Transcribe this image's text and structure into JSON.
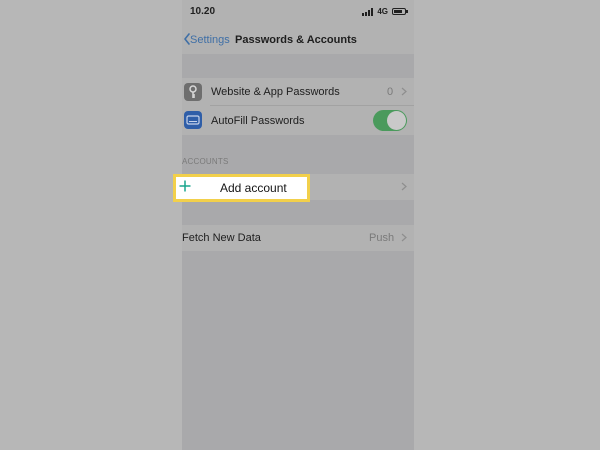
{
  "status_bar": {
    "time": "10.20",
    "network": "4G",
    "signal_icon": "cellular-signal-icon",
    "battery_icon": "battery-icon"
  },
  "nav": {
    "back_label": "Settings",
    "title": "Passwords & Accounts"
  },
  "passwords": {
    "website_label": "Website & App Passwords",
    "website_count": "0",
    "website_icon": "key-icon",
    "autofill_label": "AutoFill Passwords",
    "autofill_icon": "autofill-icon",
    "autofill_enabled": true
  },
  "accounts": {
    "section_header": "ACCOUNTS",
    "add_label": "Add account",
    "add_icon": "plus-icon"
  },
  "fetch": {
    "label": "Fetch New Data",
    "value": "Push"
  },
  "colors": {
    "highlight_border": "#f2d04b",
    "accent_blue": "#3f6fa6",
    "toggle_on": "#4a9a5c",
    "plus_icon": "#1aa58d"
  }
}
